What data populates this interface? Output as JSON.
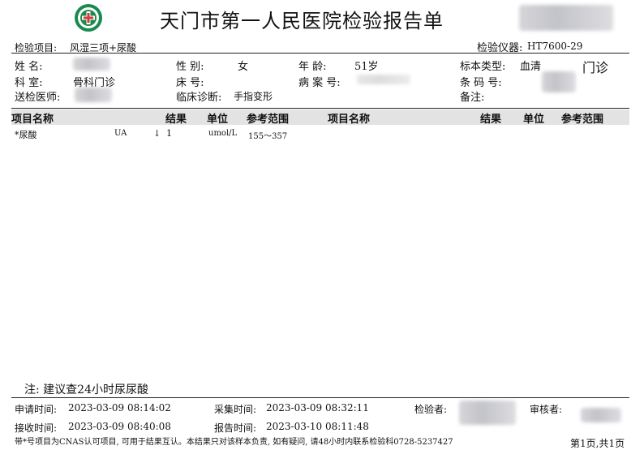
{
  "header": {
    "title": "天门市第一人民医院检验报告单",
    "right_side_label": "门诊"
  },
  "info": {
    "test_item_label": "检验项目:",
    "test_item_value": "风湿三项+尿酸",
    "instrument_label": "检验仪器:",
    "instrument_value": "HT7600-29",
    "name_label": "姓      名:",
    "gender_label": "性      别:",
    "gender_value": "女",
    "age_label": "年      龄:",
    "age_value": "51岁",
    "specimen_type_label": "标本类型:",
    "specimen_type_value": "血清",
    "department_label": "科      室:",
    "department_value": "骨科门诊",
    "bed_label": "床      号:",
    "record_label": "病 案 号:",
    "barcode_label": "条 码 号:",
    "doctor_label": "送检医师:",
    "diagnosis_label": "临床诊断:",
    "diagnosis_value": "手指变形",
    "remarks_label": "备注:"
  },
  "table": {
    "headers": [
      "项目名称",
      "结果",
      "单位",
      "参考范围",
      "项目名称",
      "结果",
      "单位",
      "参考范围"
    ],
    "rows": [
      {
        "name": "*尿酸",
        "code": "UA",
        "flag": "↓",
        "result": "1",
        "unit": "umol/L",
        "range": "155～357"
      }
    ]
  },
  "footer": {
    "note": "注:  建议查24小时尿尿酸",
    "request_time_label": "申请时间:",
    "request_time": "2023-03-09 08:14:02",
    "collect_time_label": "采集时间:",
    "collect_time": "2023-03-09 08:32:11",
    "tester_label": "检验者:",
    "reviewer_label": "审核者:",
    "receive_time_label": "接收时间:",
    "receive_time": "2023-03-09 08:40:08",
    "report_time_label": "报告时间:",
    "report_time": "2023-03-10 08:11:48",
    "disclaimer": "带*号项目为CNAS认可项目, 可用于结果互认。本结果只对该样本负责, 如有疑问, 请48小时内联系检验科0728-5237427",
    "page_info": "第1页,共1页"
  },
  "colors": {
    "logo_green": "#1a8a4e",
    "header_bg": "#e3e3e3"
  }
}
